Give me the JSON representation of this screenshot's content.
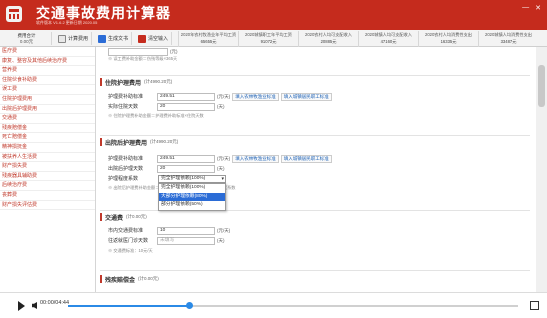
{
  "app": {
    "title": "交通事故费用计算器",
    "subtitle": "软件版本 V1.6.2  更新日期 2020.05"
  },
  "toolbar": {
    "fee_total_label": "费用合计",
    "fee_total_value": "0.00元",
    "calc_label": "计算费用",
    "generate_label": "生成文书",
    "clear_label": "清空输入"
  },
  "summary": [
    {
      "label": "2020年农村牧渔业年平均工资",
      "value": "65655元"
    },
    {
      "label": "2020城镇职工年平均工资",
      "value": "91072元"
    },
    {
      "label": "2020农村人均可支配收入",
      "value": "20885元"
    },
    {
      "label": "2020城镇人均可支配收入",
      "value": "47160元"
    },
    {
      "label": "2020农村人均消费性支出",
      "value": "16335元"
    },
    {
      "label": "2020城镇人均消费性支出",
      "value": "33487元"
    }
  ],
  "sidebar": {
    "items": [
      "医疗费",
      "康复、整容及其他后续治疗费",
      "营养费",
      "住院伙食补助费",
      "误工费",
      "住院护理费用",
      "出院后护理费用",
      "交通费",
      "残疾赔偿金",
      "死亡赔偿金",
      "精神损抚金",
      "被扶养人生活费",
      "财产损失费",
      "残疾器具辅助费",
      "后续治疗费",
      "丧葬费",
      "财产损失评估费"
    ]
  },
  "top_partial": {
    "input_value": "",
    "unit": "(元)",
    "note": "※ 误工费补助金额＝伤残等级×365天"
  },
  "inpatient": {
    "title": "住院护理费用",
    "limit": "(计4990.20元)",
    "rows": [
      {
        "label": "护理费补助标准",
        "value": "249.51",
        "unit": "(元/天)"
      },
      {
        "label": "实际住院天数",
        "value": "20",
        "unit": "(天)"
      }
    ],
    "link1": "填入农林牧渔业标准",
    "link2": "填入城镇居民职工标准",
    "note": "※ 住院护理费补助金额＝护理费补助标准×住院天数"
  },
  "outpatient": {
    "title": "出院后护理费用",
    "limit": "(计4990.20元)",
    "rows": [
      {
        "label": "护理费补助标准",
        "value": "249.51",
        "unit": "(元/天)"
      },
      {
        "label": "出院后护理天数",
        "value": "20",
        "unit": "(天)"
      },
      {
        "label": "护理程度系数",
        "value": "",
        "unit": ""
      }
    ],
    "link1": "填入农林牧渔业标准",
    "link2": "填入城镇居民职工标准",
    "note": "※ 出院后护理费补助金额＝护理费补助标准×护理天数×护理程度系数",
    "dropdown_value": "完全护理依赖(100%)",
    "dropdown_options": [
      "完全护理依赖(100%)",
      "大部分护理依赖(80%)",
      "部分护理依赖(50%)"
    ],
    "dropdown_selected": "大部分护理依赖(80%)"
  },
  "transport": {
    "title": "交通费",
    "limit": "(计0.00元)",
    "rows": [
      {
        "label": "市内交通费标准",
        "value": "10",
        "unit": "(元/天)"
      },
      {
        "label": "往返就医门诊天数",
        "value": "未填写",
        "unit": "(天)"
      }
    ],
    "note": "※ 交通费标准：10元/天"
  },
  "disability": {
    "title": "残疾赔偿金",
    "limit": "(计0.00元)"
  },
  "player": {
    "time": "00:00/04:44",
    "progress": 0.27
  },
  "colors": {
    "brand_red": "#c52b1d",
    "link_blue": "#1a5fb4",
    "selection_blue": "#2b6cd6",
    "progress_blue": "#2b8ae6"
  }
}
